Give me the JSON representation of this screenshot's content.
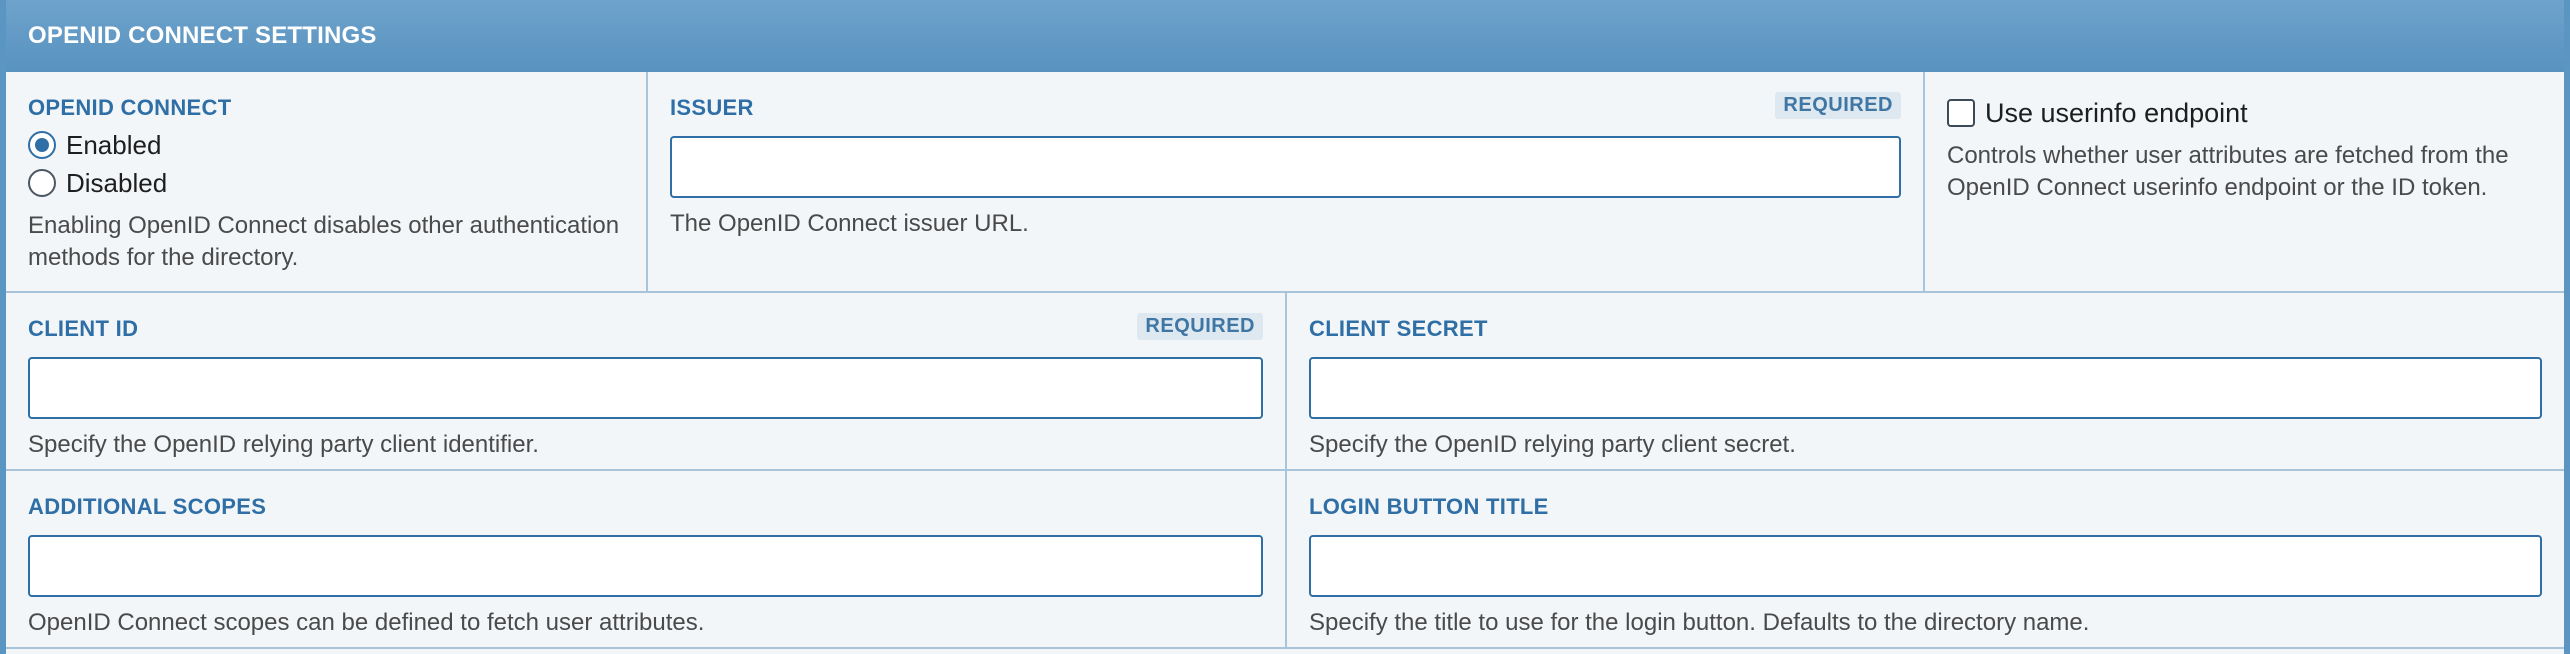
{
  "panel": {
    "title": "OPENID CONNECT SETTINGS"
  },
  "openid_connect": {
    "label": "OPENID CONNECT",
    "options": [
      {
        "label": "Enabled",
        "checked": true
      },
      {
        "label": "Disabled",
        "checked": false
      }
    ],
    "help": "Enabling OpenID Connect disables other authentication methods for the directory."
  },
  "issuer": {
    "label": "ISSUER",
    "required": "REQUIRED",
    "value": "",
    "help": "The OpenID Connect issuer URL."
  },
  "userinfo": {
    "label": "Use userinfo endpoint",
    "checked": false,
    "help": "Controls whether user attributes are fetched from the OpenID Connect userinfo endpoint or the ID token."
  },
  "client_id": {
    "label": "CLIENT ID",
    "required": "REQUIRED",
    "value": "",
    "help": "Specify the OpenID relying party client identifier."
  },
  "client_secret": {
    "label": "CLIENT SECRET",
    "value": "",
    "help": "Specify the OpenID relying party client secret."
  },
  "additional_scopes": {
    "label": "ADDITIONAL SCOPES",
    "value": "",
    "help": "OpenID Connect scopes can be defined to fetch user attributes."
  },
  "login_button_title": {
    "label": "LOGIN BUTTON TITLE",
    "value": "",
    "help": "Specify the title to use for the login button. Defaults to the directory name."
  },
  "colors": {
    "header": "#5b95c2",
    "label": "#2f6fa5",
    "border": "#a9c5dc",
    "background": "#f2f6f9"
  }
}
